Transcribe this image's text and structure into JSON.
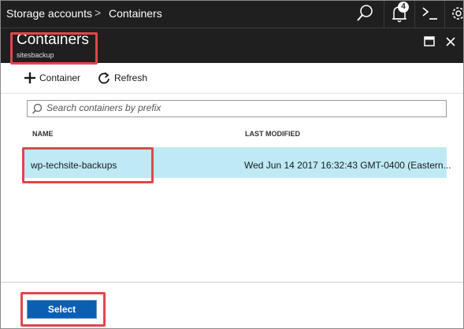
{
  "breadcrumb": {
    "items": [
      "Storage accounts",
      "Containers"
    ],
    "separator": ">"
  },
  "topbar": {
    "notification_count": "4",
    "icons": [
      "search-icon",
      "bell-icon",
      "cloud-shell-icon",
      "gear-icon"
    ]
  },
  "blade": {
    "title": "Containers",
    "subtitle": "sitesbackup",
    "controls": [
      "maximize-icon",
      "close-icon"
    ]
  },
  "toolbar": {
    "add_label": "Container",
    "refresh_label": "Refresh"
  },
  "search": {
    "placeholder": "Search containers by prefix",
    "value": ""
  },
  "table": {
    "columns": [
      "NAME",
      "LAST MODIFIED"
    ],
    "rows": [
      {
        "name": "wp-techsite-backups",
        "last_modified": "Wed Jun 14 2017 16:32:43 GMT-0400 (Eastern..."
      }
    ],
    "selected_row": 0
  },
  "footer": {
    "select_label": "Select"
  },
  "colors": {
    "topbar_bg": "#1f1f1f",
    "selected_row_bg": "#bfeaf5",
    "primary_button": "#0b5fb3",
    "highlight_outline": "#e0474c"
  }
}
